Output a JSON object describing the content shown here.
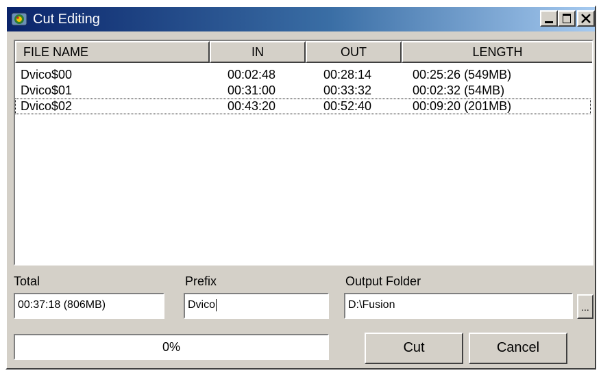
{
  "window": {
    "title": "Cut Editing",
    "icon": "app-icon"
  },
  "list": {
    "columns": [
      "FILE NAME",
      "IN",
      "OUT",
      "LENGTH"
    ],
    "rows": [
      {
        "name": "Dvico$00",
        "in": "00:02:48",
        "out": "00:28:14",
        "length": "00:25:26 (549MB)"
      },
      {
        "name": "Dvico$01",
        "in": "00:31:00",
        "out": "00:33:32",
        "length": "00:02:32 (54MB)"
      },
      {
        "name": "Dvico$02",
        "in": "00:43:20",
        "out": "00:52:40",
        "length": "00:09:20 (201MB)"
      }
    ],
    "focused_row": 2
  },
  "total": {
    "label": "Total",
    "value": "00:37:18 (806MB)"
  },
  "prefix": {
    "label": "Prefix",
    "value": "Dvico"
  },
  "output_folder": {
    "label": "Output Folder",
    "value": "D:\\Fusion",
    "browse_label": "..."
  },
  "progress": {
    "text": "0%",
    "value": 0
  },
  "buttons": {
    "cut": "Cut",
    "cancel": "Cancel"
  }
}
